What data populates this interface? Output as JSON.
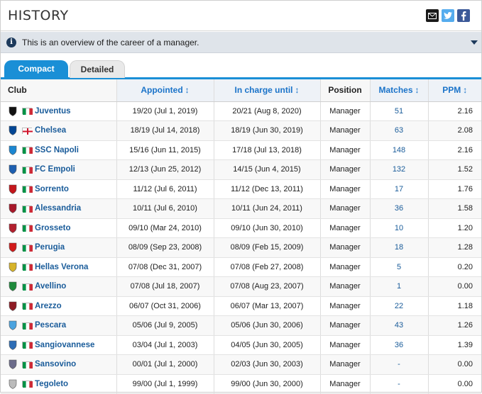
{
  "header": {
    "title": "HISTORY"
  },
  "info": {
    "text": "This is an overview of the career of a manager."
  },
  "tabs": [
    {
      "label": "Compact",
      "active": true
    },
    {
      "label": "Detailed",
      "active": false
    }
  ],
  "columns": {
    "club": "Club",
    "appointed": "Appointed",
    "in_charge_until": "In charge until",
    "position": "Position",
    "matches": "Matches",
    "ppm": "PPM",
    "sort_glyph": "↕"
  },
  "colors": {
    "accent": "#1a8fd6",
    "link": "#1a5c9a",
    "italy_green": "#009246",
    "italy_red": "#ce2b37",
    "england_red": "#cf142b"
  },
  "rows": [
    {
      "club": "Juventus",
      "crest": "juventus-crest-icon",
      "crest_color": "#111111",
      "flag": "italy",
      "appointed": "19/20 (Jul 1, 2019)",
      "until": "20/21 (Aug 8, 2020)",
      "position": "Manager",
      "matches": "51",
      "ppm": "2.16"
    },
    {
      "club": "Chelsea",
      "crest": "chelsea-crest-icon",
      "crest_color": "#034694",
      "flag": "england",
      "appointed": "18/19 (Jul 14, 2018)",
      "until": "18/19 (Jun 30, 2019)",
      "position": "Manager",
      "matches": "63",
      "ppm": "2.08"
    },
    {
      "club": "SSC Napoli",
      "crest": "napoli-crest-icon",
      "crest_color": "#1b86d1",
      "flag": "italy",
      "appointed": "15/16 (Jun 11, 2015)",
      "until": "17/18 (Jul 13, 2018)",
      "position": "Manager",
      "matches": "148",
      "ppm": "2.16"
    },
    {
      "club": "FC Empoli",
      "crest": "empoli-crest-icon",
      "crest_color": "#1d5fb0",
      "flag": "italy",
      "appointed": "12/13 (Jun 25, 2012)",
      "until": "14/15 (Jun 4, 2015)",
      "position": "Manager",
      "matches": "132",
      "ppm": "1.52"
    },
    {
      "club": "Sorrento",
      "crest": "sorrento-crest-icon",
      "crest_color": "#c4161c",
      "flag": "italy",
      "appointed": "11/12 (Jul 6, 2011)",
      "until": "11/12 (Dec 13, 2011)",
      "position": "Manager",
      "matches": "17",
      "ppm": "1.76"
    },
    {
      "club": "Alessandria",
      "crest": "alessandria-crest-icon",
      "crest_color": "#a8182a",
      "flag": "italy",
      "appointed": "10/11 (Jul 6, 2010)",
      "until": "10/11 (Jun 24, 2011)",
      "position": "Manager",
      "matches": "36",
      "ppm": "1.58"
    },
    {
      "club": "Grosseto",
      "crest": "grosseto-crest-icon",
      "crest_color": "#b3202e",
      "flag": "italy",
      "appointed": "09/10 (Mar 24, 2010)",
      "until": "09/10 (Jun 30, 2010)",
      "position": "Manager",
      "matches": "10",
      "ppm": "1.20"
    },
    {
      "club": "Perugia",
      "crest": "perugia-crest-icon",
      "crest_color": "#d11a1a",
      "flag": "italy",
      "appointed": "08/09 (Sep 23, 2008)",
      "until": "08/09 (Feb 15, 2009)",
      "position": "Manager",
      "matches": "18",
      "ppm": "1.28"
    },
    {
      "club": "Hellas Verona",
      "crest": "hellas-verona-crest-icon",
      "crest_color": "#d7b42a",
      "flag": "italy",
      "appointed": "07/08 (Dec 31, 2007)",
      "until": "07/08 (Feb 27, 2008)",
      "position": "Manager",
      "matches": "5",
      "ppm": "0.20"
    },
    {
      "club": "Avellino",
      "crest": "avellino-crest-icon",
      "crest_color": "#1e8a3c",
      "flag": "italy",
      "appointed": "07/08 (Jul 18, 2007)",
      "until": "07/08 (Aug 23, 2007)",
      "position": "Manager",
      "matches": "1",
      "ppm": "0.00"
    },
    {
      "club": "Arezzo",
      "crest": "arezzo-crest-icon",
      "crest_color": "#8e1b24",
      "flag": "italy",
      "appointed": "06/07 (Oct 31, 2006)",
      "until": "06/07 (Mar 13, 2007)",
      "position": "Manager",
      "matches": "22",
      "ppm": "1.18"
    },
    {
      "club": "Pescara",
      "crest": "pescara-crest-icon",
      "crest_color": "#4aa3df",
      "flag": "italy",
      "appointed": "05/06 (Jul 9, 2005)",
      "until": "05/06 (Jun 30, 2006)",
      "position": "Manager",
      "matches": "43",
      "ppm": "1.26"
    },
    {
      "club": "Sangiovannese",
      "crest": "sangiovannese-crest-icon",
      "crest_color": "#2d6db5",
      "flag": "italy",
      "appointed": "03/04 (Jul 1, 2003)",
      "until": "04/05 (Jun 30, 2005)",
      "position": "Manager",
      "matches": "36",
      "ppm": "1.39"
    },
    {
      "club": "Sansovino",
      "crest": "sansovino-crest-icon",
      "crest_color": "#6b6b8a",
      "flag": "italy",
      "appointed": "00/01 (Jul 1, 2000)",
      "until": "02/03 (Jun 30, 2003)",
      "position": "Manager",
      "matches": "-",
      "ppm": "0.00"
    },
    {
      "club": "Tegoleto",
      "crest": "tegoleto-crest-icon",
      "crest_color": "#bbbbbb",
      "flag": "italy",
      "appointed": "99/00 (Jul 1, 1999)",
      "until": "99/00 (Jun 30, 2000)",
      "position": "Manager",
      "matches": "-",
      "ppm": "0.00"
    }
  ]
}
